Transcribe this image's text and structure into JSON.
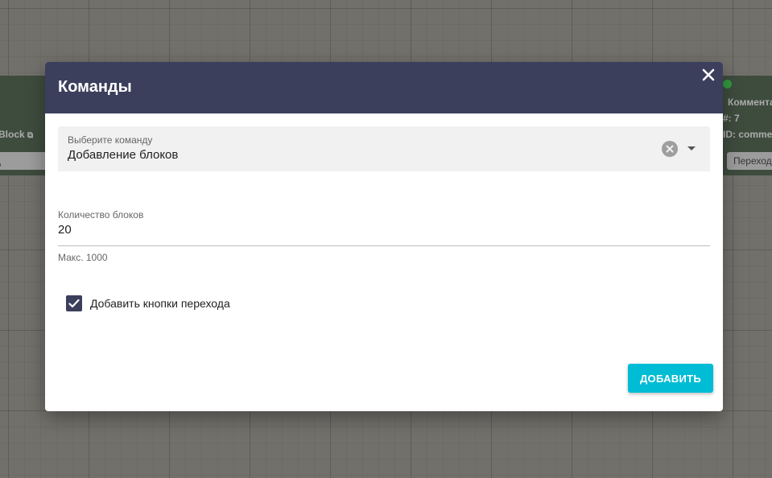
{
  "background": {
    "left_node": {
      "title": "Block",
      "button": "д"
    },
    "right_node": {
      "title": "Коммента",
      "number": "#: 7",
      "id_text": "ID: comme",
      "button": "Переход"
    }
  },
  "modal": {
    "title": "Команды",
    "close_icon": "close-icon",
    "command_select": {
      "label": "Выберите команду",
      "value": "Добавление блоков"
    },
    "block_count": {
      "label": "Количество блоков",
      "value": "20",
      "hint": "Макс. 1000"
    },
    "nav_buttons_checkbox": {
      "label": "Добавить кнопки перехода",
      "checked": true
    },
    "add_button": "ДОБАВИТЬ"
  },
  "colors": {
    "header": "#3b3f5c",
    "accent": "#00bcd4",
    "node": "#3f5540",
    "status_online": "#2ecc40"
  }
}
